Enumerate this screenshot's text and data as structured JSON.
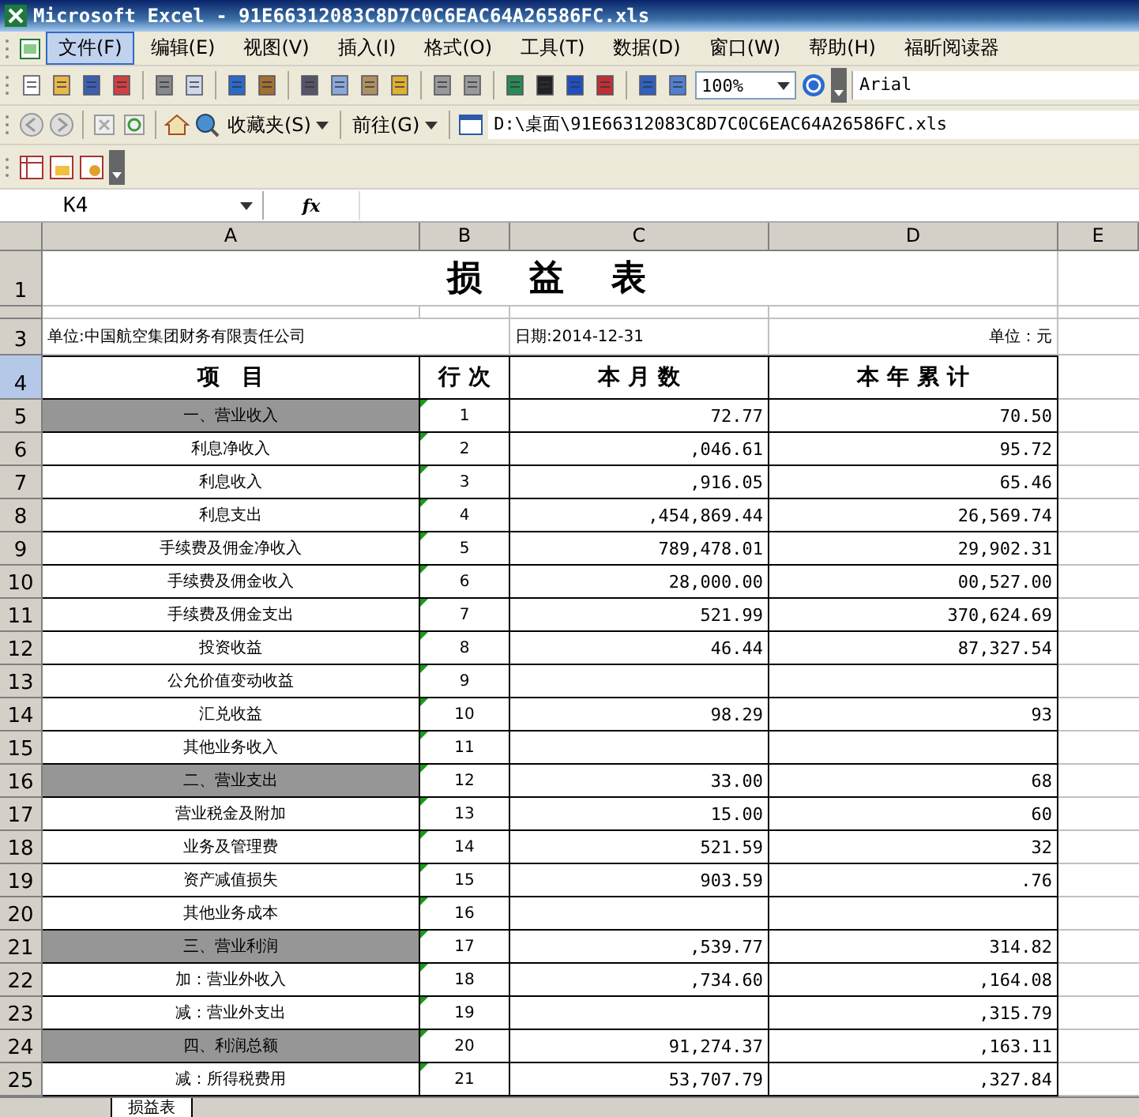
{
  "window": {
    "title": "Microsoft Excel - 91E66312083C8D7C0C6EAC64A26586FC.xls"
  },
  "menu_bar": [
    {
      "label": "文件(F)",
      "selected": true
    },
    {
      "label": "编辑(E)",
      "selected": false
    },
    {
      "label": "视图(V)",
      "selected": false
    },
    {
      "label": "插入(I)",
      "selected": false
    },
    {
      "label": "格式(O)",
      "selected": false
    },
    {
      "label": "工具(T)",
      "selected": false
    },
    {
      "label": "数据(D)",
      "selected": false
    },
    {
      "label": "窗口(W)",
      "selected": false
    },
    {
      "label": "帮助(H)",
      "selected": false
    },
    {
      "label": "福昕阅读器",
      "selected": false
    }
  ],
  "toolbar": {
    "zoom": "100%",
    "font": "Arial"
  },
  "web_toolbar": {
    "favorites": "收藏夹(S)",
    "go": "前往(G)",
    "address": "D:\\桌面\\91E66312083C8D7C0C6EAC64A26586FC.xls"
  },
  "formula_bar": {
    "name_box": "K4",
    "fx_label": "fx"
  },
  "columns": [
    {
      "label": "A",
      "selected": false
    },
    {
      "label": "B",
      "selected": false
    },
    {
      "label": "C",
      "selected": false
    },
    {
      "label": "D",
      "selected": false
    },
    {
      "label": "E",
      "selected": false
    }
  ],
  "sheet": {
    "title_row": "1",
    "unit_row": "3",
    "title": "损　益　表",
    "unit": "单位:中国航空集团财务有限责任公司",
    "date": "日期:2014-12-31",
    "unit_right": "单位：元",
    "header_row": "4",
    "header_selected": true,
    "headers": [
      "项　目",
      "行 次",
      "本 月 数",
      "本 年 累 计"
    ],
    "rows": [
      {
        "row": "5",
        "kind": "section",
        "item": "一、营业收入",
        "line": "1",
        "month": "72.77",
        "year": "70.50",
        "flagged": true
      },
      {
        "row": "6",
        "kind": "item",
        "item": "利息净收入",
        "line": "2",
        "month": ",046.61",
        "year": "95.72",
        "flagged": true
      },
      {
        "row": "7",
        "kind": "item",
        "item": "利息收入",
        "line": "3",
        "month": ",916.05",
        "year": "65.46",
        "flagged": true
      },
      {
        "row": "8",
        "kind": "item",
        "item": "利息支出",
        "line": "4",
        "month": ",454,869.44",
        "year": "26,569.74",
        "flagged": true
      },
      {
        "row": "9",
        "kind": "item",
        "item": "手续费及佣金净收入",
        "line": "5",
        "month": "789,478.01",
        "year": "29,902.31",
        "flagged": true
      },
      {
        "row": "10",
        "kind": "item",
        "item": "手续费及佣金收入",
        "line": "6",
        "month": "28,000.00",
        "year": "00,527.00",
        "flagged": true
      },
      {
        "row": "11",
        "kind": "item",
        "item": "手续费及佣金支出",
        "line": "7",
        "month": "521.99",
        "year": "370,624.69",
        "flagged": true
      },
      {
        "row": "12",
        "kind": "item",
        "item": "投资收益",
        "line": "8",
        "month": "46.44",
        "year": "87,327.54",
        "flagged": true
      },
      {
        "row": "13",
        "kind": "item",
        "item": "公允价值变动收益",
        "line": "9",
        "month": "",
        "year": "",
        "flagged": true
      },
      {
        "row": "14",
        "kind": "item",
        "item": "汇兑收益",
        "line": "10",
        "month": "98.29",
        "year": "93",
        "flagged": true
      },
      {
        "row": "15",
        "kind": "item",
        "item": "其他业务收入",
        "line": "11",
        "month": "",
        "year": "",
        "flagged": true
      },
      {
        "row": "16",
        "kind": "section",
        "item": "二、营业支出",
        "line": "12",
        "month": "33.00",
        "year": "68",
        "flagged": true
      },
      {
        "row": "17",
        "kind": "item",
        "item": "营业税金及附加",
        "line": "13",
        "month": "15.00",
        "year": "60",
        "flagged": true
      },
      {
        "row": "18",
        "kind": "item",
        "item": "业务及管理费",
        "line": "14",
        "month": "521.59",
        "year": "32",
        "flagged": true
      },
      {
        "row": "19",
        "kind": "item",
        "item": "资产减值损失",
        "line": "15",
        "month": "903.59",
        "year": ".76",
        "flagged": true
      },
      {
        "row": "20",
        "kind": "item",
        "item": "其他业务成本",
        "line": "16",
        "month": "",
        "year": "",
        "flagged": true
      },
      {
        "row": "21",
        "kind": "section",
        "item": "三、营业利润",
        "line": "17",
        "month": ",539.77",
        "year": "314.82",
        "flagged": true
      },
      {
        "row": "22",
        "kind": "item",
        "item": "加：营业外收入",
        "line": "18",
        "month": ",734.60",
        "year": ",164.08",
        "flagged": true
      },
      {
        "row": "23",
        "kind": "item",
        "item": "减：营业外支出",
        "line": "19",
        "month": "",
        "year": ",315.79",
        "flagged": true
      },
      {
        "row": "24",
        "kind": "section",
        "item": "四、利润总额",
        "line": "20",
        "month": "91,274.37",
        "year": ",163.11",
        "flagged": true
      },
      {
        "row": "25",
        "kind": "item",
        "item": "减：所得税费用",
        "line": "21",
        "month": "53,707.79",
        "year": ",327.84",
        "flagged": true
      }
    ]
  },
  "sheet_tabs": [
    {
      "label": "损益表",
      "selected": true
    }
  ]
}
